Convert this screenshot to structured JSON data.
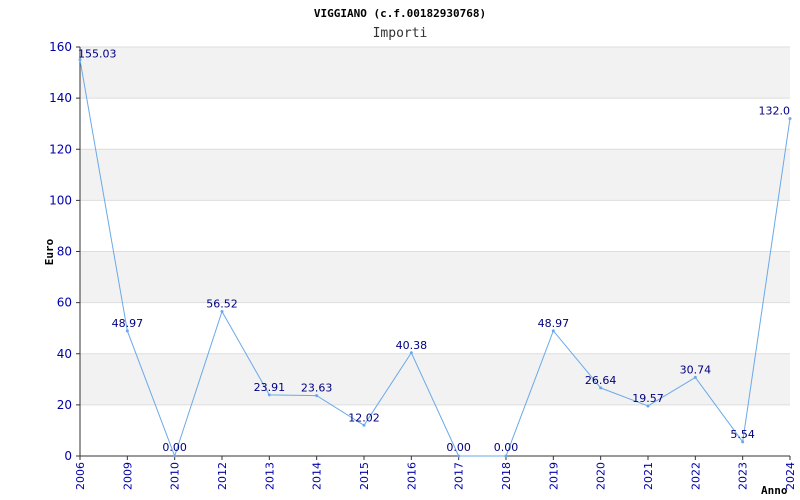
{
  "chart_data": {
    "type": "line",
    "title": "VIGGIANO (c.f.00182930768)",
    "subtitle": "Importi",
    "ylabel": "Euro",
    "xlabel": "Anno",
    "ylim": [
      0,
      160
    ],
    "yticks": [
      0,
      20,
      40,
      60,
      80,
      100,
      120,
      140,
      160
    ],
    "categories": [
      "2006",
      "2009",
      "2010",
      "2012",
      "2013",
      "2014",
      "2015",
      "2016",
      "2017",
      "2018",
      "2019",
      "2020",
      "2021",
      "2022",
      "2023",
      "2024"
    ],
    "values": [
      155.03,
      48.97,
      0.0,
      56.52,
      23.91,
      23.63,
      12.02,
      40.38,
      0.0,
      0.0,
      48.97,
      26.64,
      19.57,
      30.74,
      5.54,
      132.0
    ],
    "value_labels": [
      "155.03",
      "48.97",
      "0.00",
      "56.52",
      "23.91",
      "23.63",
      "12.02",
      "40.38",
      "0.00",
      "0.00",
      "48.97",
      "26.64",
      "19.57",
      "30.74",
      "5.54",
      "132.0"
    ],
    "grid": true,
    "line_color": "#6aa9e9",
    "band_color": "#f2f2f2",
    "tick_color": "#0000aa"
  }
}
